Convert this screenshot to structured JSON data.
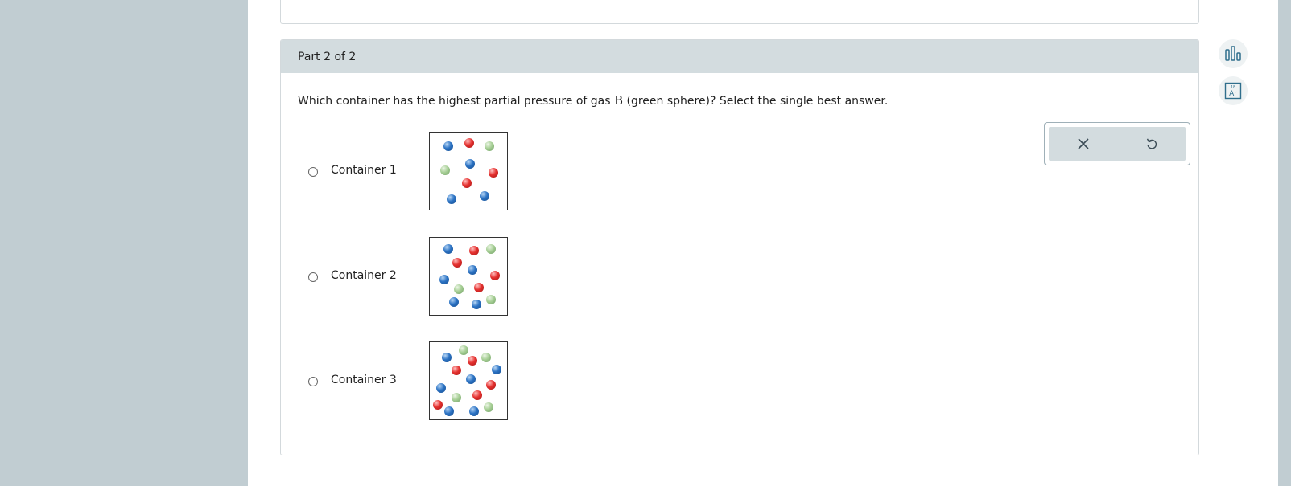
{
  "part": {
    "label": "Part 2 of 2"
  },
  "question": {
    "before": "Which container has the highest partial pressure of gas ",
    "variable": "B",
    "after": " (green sphere)? Select the single best answer."
  },
  "options": [
    {
      "label": "Container 1",
      "selected": false
    },
    {
      "label": "Container 2",
      "selected": false
    },
    {
      "label": "Container 3",
      "selected": false
    }
  ],
  "toolbox": {
    "clear_icon": "close-icon",
    "undo_icon": "undo-icon"
  },
  "side_tools": [
    {
      "icon": "data-chart-icon"
    },
    {
      "icon": "periodic-table-icon",
      "badge_number": "18",
      "badge_symbol": "Ar"
    }
  ],
  "colors": {
    "blue_sphere": "#2c73c4",
    "red_sphere": "#e5312f",
    "green_sphere": "#a7cf96",
    "header_bg": "#d3dcdf",
    "page_bg": "#c1cdd2"
  }
}
